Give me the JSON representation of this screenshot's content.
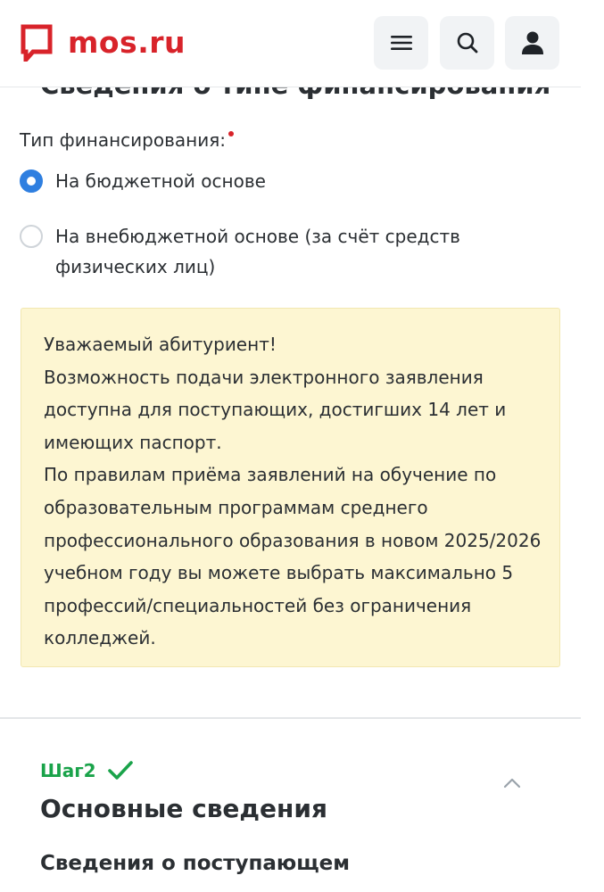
{
  "header": {
    "logo_text": "mos.ru",
    "brand_color": "#d8232a",
    "buttons": [
      "menu-icon",
      "search-icon",
      "user-icon"
    ]
  },
  "section": {
    "cut_heading": "Сведения о типе финансирования"
  },
  "financing": {
    "label": "Тип финансирования:",
    "required": true,
    "options": [
      {
        "label": "На бюджетной основе",
        "selected": true
      },
      {
        "label": "На внебюджетной основе (за счёт средств физических лиц)",
        "selected": false
      }
    ],
    "accent_color": "#2f7fe0"
  },
  "notice": {
    "background": "#fdf6d2",
    "lines": [
      "Уважаемый абитуриент!",
      "Возможность подачи электронного заявления доступна для поступающих, достигших 14 лет и имеющих паспорт.",
      "По правилам приёма заявлений на обучение по образовательным программам среднего профессионального образования в новом 2025/2026 учебном году вы можете выбрать максимально 5 профессий/специальностей без ограничения колледжей."
    ]
  },
  "step2": {
    "label": "Шаг2",
    "status_icon": "checkmark-icon",
    "status_color": "#1aa34a",
    "title": "Основные сведения",
    "subtitle": "Сведения о поступающем"
  }
}
